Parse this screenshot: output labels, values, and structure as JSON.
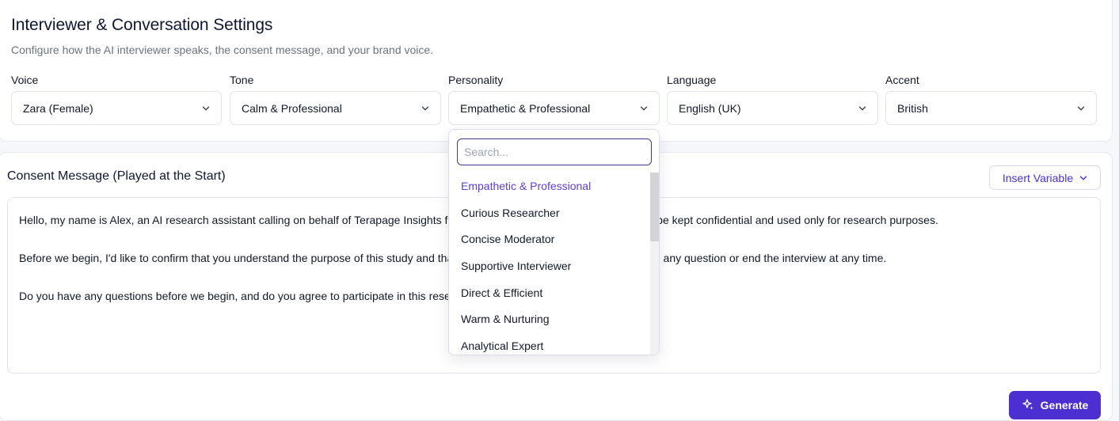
{
  "header": {
    "title": "Interviewer & Conversation Settings",
    "subtitle": "Configure how the AI interviewer speaks, the consent message, and your brand voice."
  },
  "fields": [
    {
      "label": "Voice",
      "value": "Zara (Female)"
    },
    {
      "label": "Tone",
      "value": "Calm & Professional"
    },
    {
      "label": "Personality",
      "value": "Empathetic & Professional"
    },
    {
      "label": "Language",
      "value": "English (UK)"
    },
    {
      "label": "Accent",
      "value": "British"
    }
  ],
  "personality_dropdown": {
    "search_placeholder": "Search...",
    "options": [
      "Empathetic & Professional",
      "Curious Researcher",
      "Concise Moderator",
      "Supportive Interviewer",
      "Direct & Efficient",
      "Warm & Nurturing",
      "Analytical Expert"
    ],
    "selected": "Empathetic & Professional"
  },
  "consent": {
    "title": "Consent Message (Played at the Start)",
    "insert_variable_label": "Insert Variable",
    "paragraphs": [
      "Hello, my name is Alex, an AI research assistant calling on behalf of Terapage Insights for research purposes. Your responses will be kept confidential and used only for research purposes.",
      "Before we begin, I'd like to confirm that you understand the purpose of this study and that participation is voluntary — you may skip any question or end the interview at any time.",
      "Do you have any questions before we begin, and do you agree to participate in this research?"
    ]
  },
  "generate_label": "Generate",
  "colors": {
    "accent": "#4b2fd1",
    "selected_option": "#5b3fd6",
    "title_text": "#0f1733",
    "muted_text": "#6b7280"
  }
}
